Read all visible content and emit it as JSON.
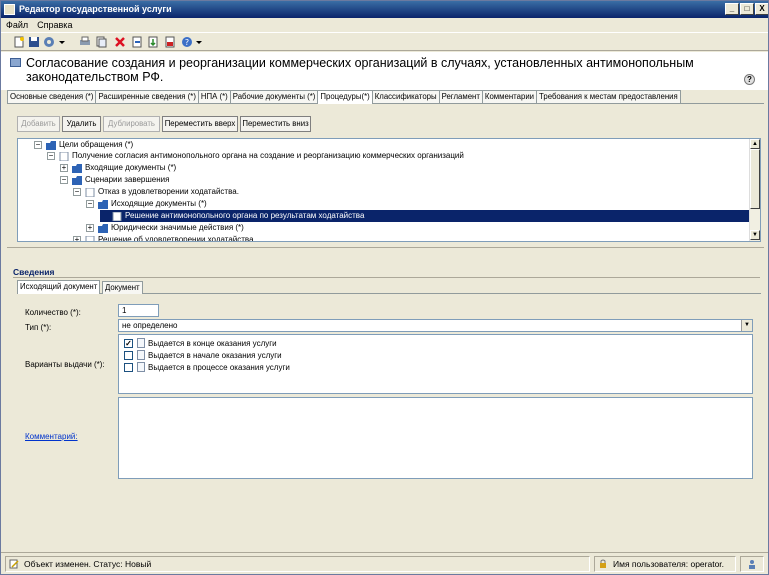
{
  "window": {
    "title": "Редактор государственной услуги"
  },
  "window_buttons": {
    "minimize": "_",
    "maximize": "□",
    "close": "X"
  },
  "menu": {
    "items": [
      "Файл",
      "Справка"
    ]
  },
  "toolbar": {
    "icons": [
      "new-icon",
      "save-icon",
      "settings-icon",
      "print-icon",
      "copy-icon",
      "delete-icon",
      "export-icon",
      "import-icon",
      "pdf-icon",
      "help-icon"
    ]
  },
  "header": {
    "title": "Согласование создания и реорганизации коммерческих организаций в случаях, установленных антимонопольным законодательством РФ.",
    "help": "?"
  },
  "tabs": [
    {
      "label": "Основные сведения (*)",
      "active": false
    },
    {
      "label": "Расширенные сведения (*)",
      "active": false
    },
    {
      "label": "НПА (*)",
      "active": false
    },
    {
      "label": "Рабочие документы (*)",
      "active": false
    },
    {
      "label": "Процедуры(*)",
      "active": true
    },
    {
      "label": "Классификаторы",
      "active": false
    },
    {
      "label": "Регламент",
      "active": false
    },
    {
      "label": "Комментарии",
      "active": false
    },
    {
      "label": "Требования к местам предоставления",
      "active": false
    }
  ],
  "actions": {
    "add": "Добавить",
    "delete": "Удалить",
    "duplicate": "Дублировать",
    "move_up": "Переместить вверх",
    "move_down": "Переместить вниз"
  },
  "tree": [
    {
      "label": "Цели обращения (*)",
      "expander": "−",
      "icon": "folder"
    },
    {
      "label": "Получение согласия  антимонопольного органа на  создание и реорганизацию коммерческих организаций",
      "expander": "−",
      "icon": "doc"
    },
    {
      "label": "Входящие документы (*)",
      "expander": "+",
      "icon": "folder"
    },
    {
      "label": "Сценарии завершения",
      "expander": "−",
      "icon": "folder"
    },
    {
      "label": "Отказ в удовлетворении ходатайства.",
      "expander": "−",
      "icon": "doc"
    },
    {
      "label": "Исходящие документы (*)",
      "expander": "−",
      "icon": "folder"
    },
    {
      "label": "Решение антимонопольного органа по результатам ходатайства",
      "expander": "",
      "icon": "doc",
      "selected": true
    },
    {
      "label": "Юридически значимые действия (*)",
      "expander": "+",
      "icon": "folder"
    },
    {
      "label": "Решение об удовлетворении ходатайства.",
      "expander": "+",
      "icon": "doc"
    }
  ],
  "details": {
    "heading": "Сведения",
    "subtabs": [
      {
        "label": "Исходящий документ",
        "active": true
      },
      {
        "label": "Документ",
        "active": false
      }
    ],
    "quantity_label": "Количество (*):",
    "quantity_value": "1",
    "type_label": "Тип (*):",
    "type_value": "не определено",
    "variants_label": "Варианты выдачи (*):",
    "variants": [
      {
        "label": "Выдается в конце оказания услуги",
        "checked": true
      },
      {
        "label": "Выдается в начале оказания услуги",
        "checked": false
      },
      {
        "label": "Выдается в процессе оказания услуги",
        "checked": false
      }
    ],
    "comment_label": "Комментарий:"
  },
  "status": {
    "left": "Объект изменен. Статус: Новый",
    "user": "Имя пользователя: operator."
  }
}
